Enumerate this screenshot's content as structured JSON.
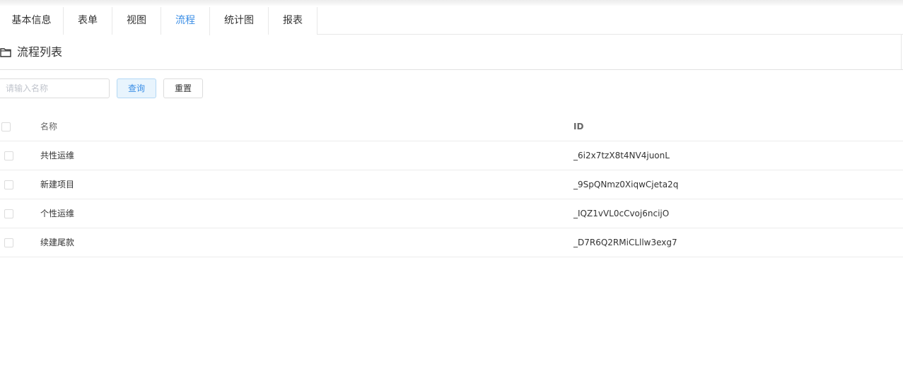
{
  "tabs": [
    {
      "label": "基本信息"
    },
    {
      "label": "表单"
    },
    {
      "label": "视图"
    },
    {
      "label": "流程"
    },
    {
      "label": "统计图"
    },
    {
      "label": "报表"
    }
  ],
  "active_tab": "流程",
  "section": {
    "title": "流程列表",
    "icon": "folder-icon"
  },
  "search": {
    "placeholder": "请输入名称",
    "value": ""
  },
  "buttons": {
    "query": "查询",
    "reset": "重置"
  },
  "table": {
    "columns": {
      "name": "名称",
      "id": "ID"
    },
    "rows": [
      {
        "name": "共性运维",
        "id": "_6i2x7tzX8t4NV4juonL"
      },
      {
        "name": "新建项目",
        "id": "_9SpQNmz0XiqwCjeta2q"
      },
      {
        "name": "个性运维",
        "id": "_IQZ1vVL0cCvoj6ncijO"
      },
      {
        "name": "续建尾款",
        "id": "_D7R6Q2RMiCLllw3exg7"
      }
    ]
  },
  "colors": {
    "accent": "#3a8ee6",
    "border": "#e8e8e8"
  }
}
